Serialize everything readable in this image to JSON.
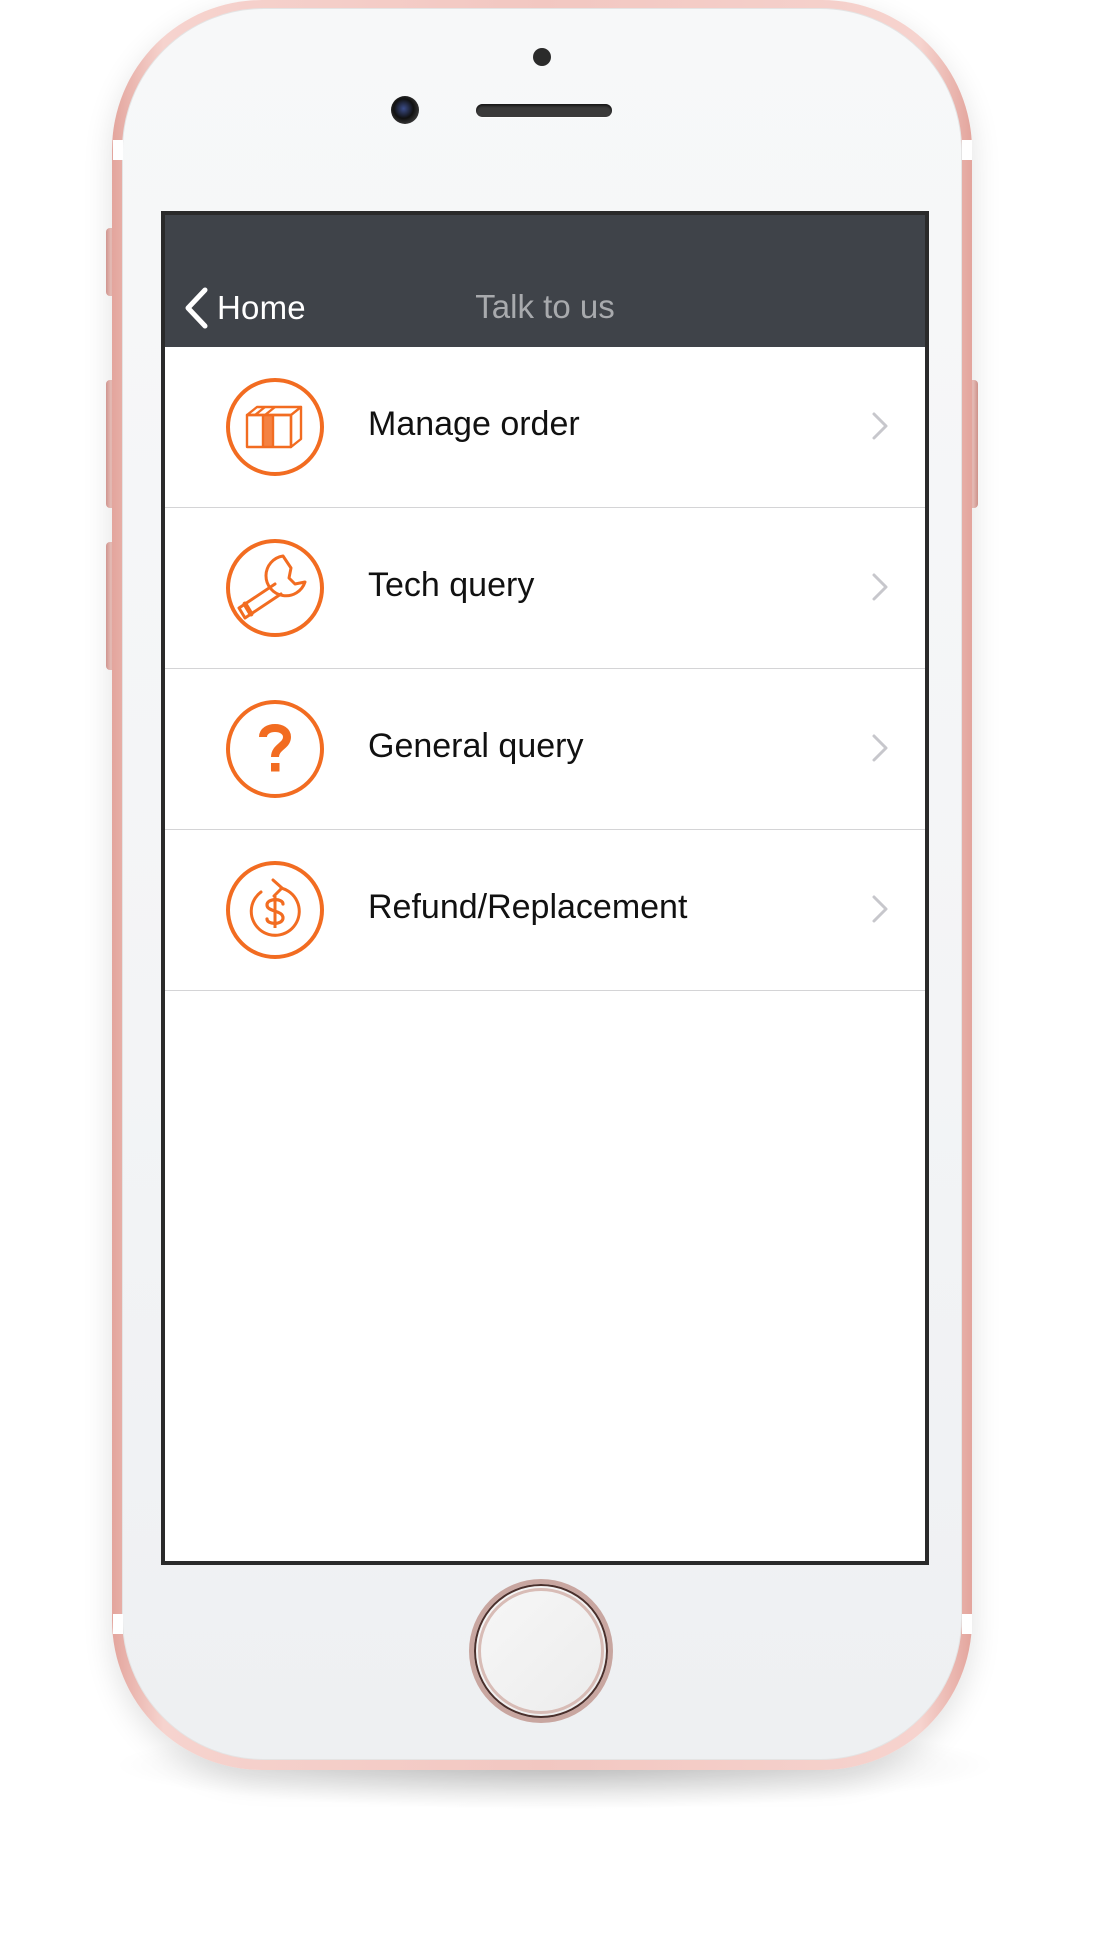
{
  "nav": {
    "back_label": "Home",
    "title": "Talk to us"
  },
  "colors": {
    "accent": "#F26C21",
    "navbar": "#3F4349",
    "title_text": "#A8AAAD",
    "divider": "#D4D4D6",
    "chevron": "#C7C7CC"
  },
  "menu": {
    "items": [
      {
        "label": "Manage order",
        "icon": "gift-box-icon"
      },
      {
        "label": "Tech query",
        "icon": "wrench-icon"
      },
      {
        "label": "General query",
        "icon": "question-mark-icon"
      },
      {
        "label": "Refund/Replacement",
        "icon": "refund-dollar-icon"
      }
    ]
  }
}
